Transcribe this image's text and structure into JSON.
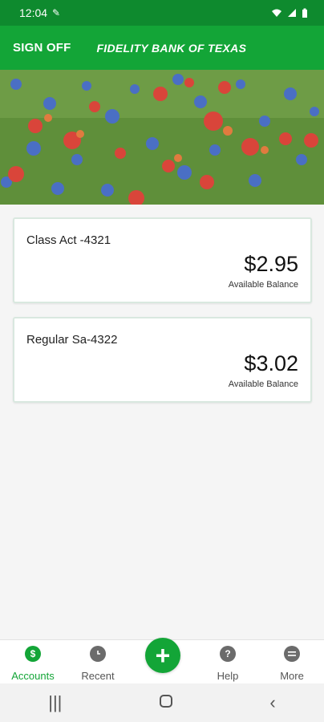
{
  "status_bar": {
    "time": "12:04",
    "notification_icon": "wrench-icon",
    "icons": [
      "wifi-icon",
      "signal-icon",
      "battery-icon"
    ]
  },
  "header": {
    "sign_off_label": "SIGN OFF",
    "title": "FIDELITY BANK OF TEXAS"
  },
  "banner": {
    "image": "wildflower-meadow"
  },
  "accounts": [
    {
      "name": "Class Act -4321",
      "amount": "$2.95",
      "subtitle": "Available Balance"
    },
    {
      "name": "Regular Sa-4322",
      "amount": "$3.02",
      "subtitle": "Available Balance"
    }
  ],
  "bottom_nav": {
    "items": [
      {
        "label": "Accounts",
        "icon": "dollar-circle-icon",
        "active": true
      },
      {
        "label": "Recent",
        "icon": "clock-icon",
        "active": false
      },
      {
        "label": "Help",
        "icon": "question-icon",
        "active": false
      },
      {
        "label": "More",
        "icon": "menu-icon",
        "active": false
      }
    ],
    "add_icon": "plus-icon"
  },
  "system_nav": {
    "icons": [
      "recents-icon",
      "home-icon",
      "back-icon"
    ]
  },
  "colors": {
    "primary": "#13a537",
    "status_bar": "#0e8a2e"
  }
}
